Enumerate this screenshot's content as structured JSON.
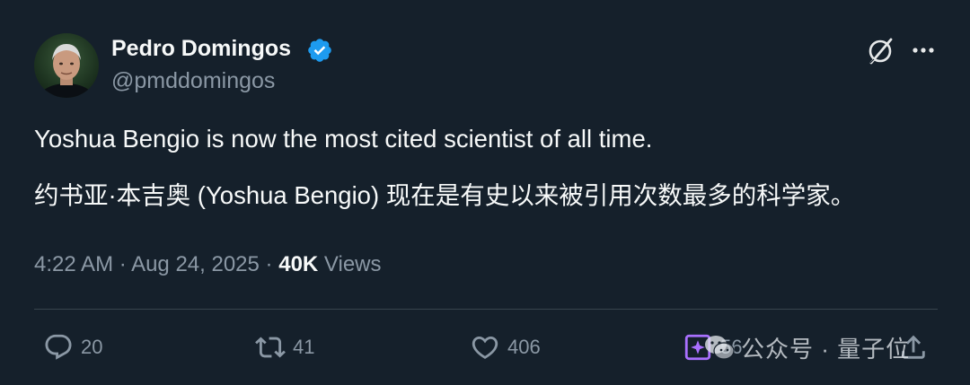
{
  "author": {
    "name": "Pedro Domingos",
    "handle": "@pmddomingos"
  },
  "tweet": {
    "line_en": "Yoshua Bengio is now the most cited scientist of all time.",
    "line_zh": "约书亚·本吉奥 (Yoshua Bengio) 现在是有史以来被引用次数最多的科学家。"
  },
  "meta": {
    "time": "4:22 AM",
    "date": "Aug 24, 2025",
    "separator": "·",
    "views_count": "40K",
    "views_label": "Views"
  },
  "actions": {
    "replies": "20",
    "retweets": "41",
    "likes": "406",
    "analytics": "56"
  },
  "watermark": {
    "text": "公众号 · 量子位"
  },
  "colors": {
    "background": "#15202b",
    "primary_text": "#f7f9f9",
    "secondary_text": "#8b98a5",
    "verified": "#1d9bf0",
    "analytics_accent": "#a970ff"
  },
  "icons": [
    "verified-badge-icon",
    "grok-icon",
    "more-icon",
    "reply-icon",
    "retweet-icon",
    "like-icon",
    "analytics-icon",
    "share-icon",
    "wechat-icon"
  ]
}
